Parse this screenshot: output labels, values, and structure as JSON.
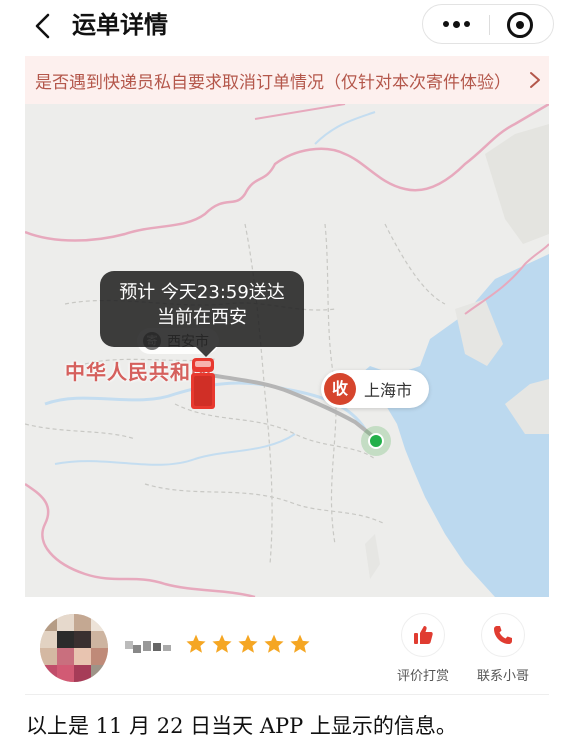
{
  "header": {
    "title": "运单详情"
  },
  "notice": {
    "text": "是否遇到快递员私自要求取消订单情况（仅针对本次寄件体验）"
  },
  "map": {
    "tooltip": {
      "line1": "预计 今天23:59送达",
      "line2": "当前在西安"
    },
    "origin_city": "西安市",
    "origin_badge": "寄",
    "country_label": "中华人民共和国",
    "destination_badge": "收",
    "destination_city": "上海市",
    "colors": {
      "truck": "#e8392f",
      "route": "#b5b5b5",
      "destination": "#23b04a",
      "sea": "#bcd9ef",
      "border": "#e7a9bd"
    }
  },
  "courier": {
    "rating_stars": 5,
    "star_color": "#f5a623",
    "actions": [
      {
        "label": "评价打赏",
        "icon": "thumbs-up-icon"
      },
      {
        "label": "联系小哥",
        "icon": "phone-icon"
      }
    ]
  },
  "caption": "以上是 11 月 22 日当天 APP 上显示的信息。"
}
